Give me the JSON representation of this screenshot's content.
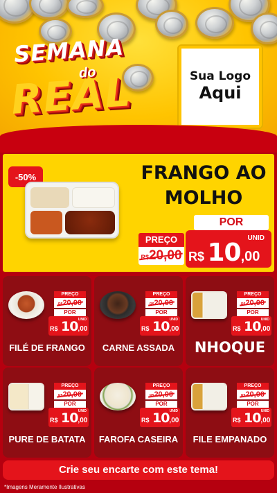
{
  "header": {
    "title_line1": "SEMANA",
    "title_connector": "do",
    "title_line2": "REAL",
    "logo_line1": "Sua Logo",
    "logo_line2": "Aqui"
  },
  "featured": {
    "discount": "-50%",
    "name": "FRANGO AO MOLHO",
    "por_label": "POR",
    "preco_label": "PREÇO",
    "old_currency": "R$",
    "old_price": "20,00",
    "unid_label": "UNID",
    "currency": "R$",
    "price_int": "10",
    "price_cents": ",00"
  },
  "products": [
    {
      "name": "FILÉ DE FRANGO",
      "preco_label": "PREÇO",
      "old_currency": "R$",
      "old_price": "20,00",
      "por_label": "POR",
      "unid_label": "UNID",
      "currency": "R$",
      "price_int": "10",
      "price_cents": ",00"
    },
    {
      "name": "CARNE ASSADA",
      "preco_label": "PREÇO",
      "old_currency": "R$",
      "old_price": "20,00",
      "por_label": "POR",
      "unid_label": "UNID",
      "currency": "R$",
      "price_int": "10",
      "price_cents": ",00"
    },
    {
      "name": "NHOQUE",
      "preco_label": "PREÇO",
      "old_currency": "R$",
      "old_price": "20,00",
      "por_label": "POR",
      "unid_label": "UNID",
      "currency": "R$",
      "price_int": "10",
      "price_cents": ",00"
    },
    {
      "name": "PURE DE BATATA",
      "preco_label": "PREÇO",
      "old_currency": "R$",
      "old_price": "20,00",
      "por_label": "POR",
      "unid_label": "UNID",
      "currency": "R$",
      "price_int": "10",
      "price_cents": ",00"
    },
    {
      "name": "FAROFA CASEIRA",
      "preco_label": "PREÇO",
      "old_currency": "R$",
      "old_price": "20,00",
      "por_label": "POR",
      "unid_label": "UNID",
      "currency": "R$",
      "price_int": "10",
      "price_cents": ",00"
    },
    {
      "name": "FILE EMPANADO",
      "preco_label": "PREÇO",
      "old_currency": "R$",
      "old_price": "20,00",
      "por_label": "POR",
      "unid_label": "UNID",
      "currency": "R$",
      "price_int": "10",
      "price_cents": ",00"
    }
  ],
  "cta": "Crie seu encarte com este tema!",
  "footnote": "*Imagens Meramente Ilustrativas",
  "colors": {
    "accent_red": "#e4141b",
    "card_bg": "#8e0d13",
    "yellow": "#ffd400"
  }
}
